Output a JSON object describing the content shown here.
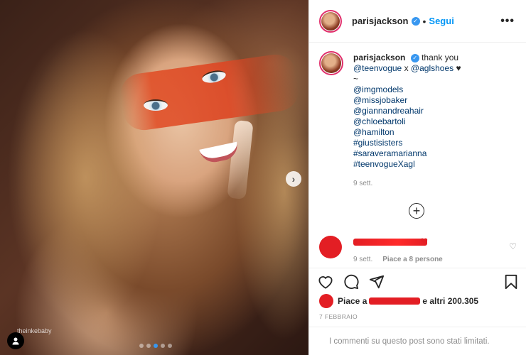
{
  "post": {
    "username": "parisjackson",
    "follow_label": "Segui",
    "more_label": "•••",
    "separator": "•",
    "image_watermark": "theinkebaby",
    "carousel": {
      "count": 5,
      "active_index": 2
    }
  },
  "caption": {
    "username": "parisjackson",
    "text": "thank you",
    "line2_a": "@teenvogue",
    "line2_sep": "x",
    "line2_b": "@aglshoes",
    "heart": "♥",
    "tilde": "~",
    "mentions": [
      "@imgmodels",
      "@missjobaker",
      "@giannandreahair",
      "@chloebartoli",
      "@hamilton",
      "#giustisisters",
      "#saraveramarianna",
      "#teenvogueXagl"
    ],
    "time": "9 sett."
  },
  "comment": {
    "emoji": "❤",
    "time": "9 sett.",
    "likes_label": "Piace a 8 persone"
  },
  "likes": {
    "prefix": "Piace a",
    "suffix": "e altri 200.305"
  },
  "date": "7 FEBBRAIO",
  "comments_limited": "I commenti su questo post sono stati limitati.",
  "icons": [
    "heart-icon",
    "comment-icon",
    "share-icon",
    "bookmark-icon",
    "plus-circle-icon",
    "more-icon",
    "verified-icon",
    "user-tag-icon",
    "next-icon"
  ],
  "colors": {
    "accent": "#0095f6",
    "verified": "#3897f0",
    "redaction": "#e31e24"
  }
}
